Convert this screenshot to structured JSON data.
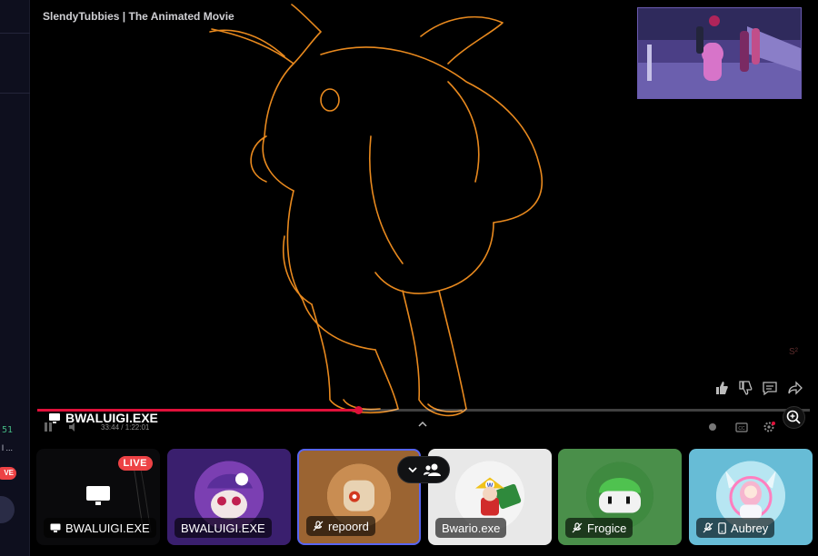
{
  "video": {
    "title": "SlendyTubbies | The Animated Movie",
    "watermark": "S²",
    "progress": 0.415,
    "time": "33:44 / 1:22:01",
    "stream_label": "BWALUIGI.EXE"
  },
  "tiles": [
    {
      "name": "BWALUIGI.EXE",
      "live_label": "LIVE",
      "muted": false,
      "icon": "monitor-icon"
    },
    {
      "name": "BWALUIGI.EXE",
      "muted": false
    },
    {
      "name": "repoord",
      "muted": true,
      "selected": true
    },
    {
      "name": "Bwario.exe",
      "muted": false
    },
    {
      "name": "Frogice",
      "muted": true
    },
    {
      "name": "Aubrey",
      "muted": true,
      "mobile": true
    }
  ],
  "sidebar": {
    "count": "51",
    "ellipsis": "l ...",
    "live_label": "VE"
  },
  "colors": {
    "accent": "#5865f2",
    "live": "#ed4245",
    "progress": "#e0103a",
    "sketch": "#e8891e"
  }
}
